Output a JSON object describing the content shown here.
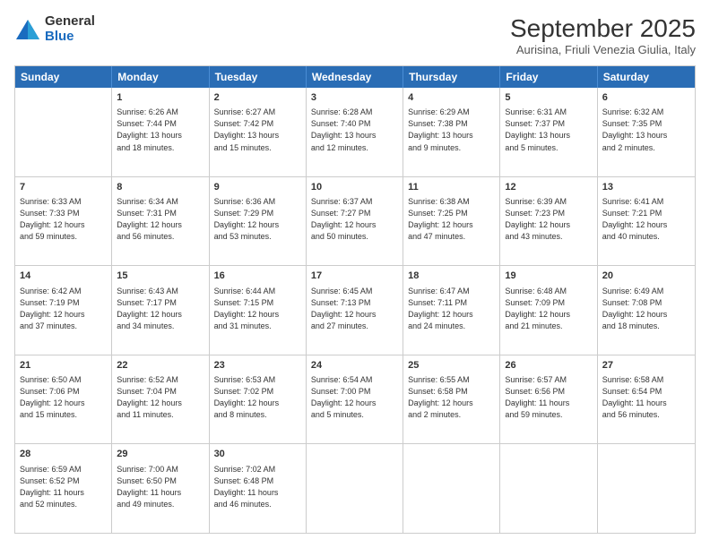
{
  "logo": {
    "general": "General",
    "blue": "Blue"
  },
  "title": "September 2025",
  "subtitle": "Aurisina, Friuli Venezia Giulia, Italy",
  "header_days": [
    "Sunday",
    "Monday",
    "Tuesday",
    "Wednesday",
    "Thursday",
    "Friday",
    "Saturday"
  ],
  "weeks": [
    [
      {
        "day": "",
        "lines": []
      },
      {
        "day": "1",
        "lines": [
          "Sunrise: 6:26 AM",
          "Sunset: 7:44 PM",
          "Daylight: 13 hours",
          "and 18 minutes."
        ]
      },
      {
        "day": "2",
        "lines": [
          "Sunrise: 6:27 AM",
          "Sunset: 7:42 PM",
          "Daylight: 13 hours",
          "and 15 minutes."
        ]
      },
      {
        "day": "3",
        "lines": [
          "Sunrise: 6:28 AM",
          "Sunset: 7:40 PM",
          "Daylight: 13 hours",
          "and 12 minutes."
        ]
      },
      {
        "day": "4",
        "lines": [
          "Sunrise: 6:29 AM",
          "Sunset: 7:38 PM",
          "Daylight: 13 hours",
          "and 9 minutes."
        ]
      },
      {
        "day": "5",
        "lines": [
          "Sunrise: 6:31 AM",
          "Sunset: 7:37 PM",
          "Daylight: 13 hours",
          "and 5 minutes."
        ]
      },
      {
        "day": "6",
        "lines": [
          "Sunrise: 6:32 AM",
          "Sunset: 7:35 PM",
          "Daylight: 13 hours",
          "and 2 minutes."
        ]
      }
    ],
    [
      {
        "day": "7",
        "lines": [
          "Sunrise: 6:33 AM",
          "Sunset: 7:33 PM",
          "Daylight: 12 hours",
          "and 59 minutes."
        ]
      },
      {
        "day": "8",
        "lines": [
          "Sunrise: 6:34 AM",
          "Sunset: 7:31 PM",
          "Daylight: 12 hours",
          "and 56 minutes."
        ]
      },
      {
        "day": "9",
        "lines": [
          "Sunrise: 6:36 AM",
          "Sunset: 7:29 PM",
          "Daylight: 12 hours",
          "and 53 minutes."
        ]
      },
      {
        "day": "10",
        "lines": [
          "Sunrise: 6:37 AM",
          "Sunset: 7:27 PM",
          "Daylight: 12 hours",
          "and 50 minutes."
        ]
      },
      {
        "day": "11",
        "lines": [
          "Sunrise: 6:38 AM",
          "Sunset: 7:25 PM",
          "Daylight: 12 hours",
          "and 47 minutes."
        ]
      },
      {
        "day": "12",
        "lines": [
          "Sunrise: 6:39 AM",
          "Sunset: 7:23 PM",
          "Daylight: 12 hours",
          "and 43 minutes."
        ]
      },
      {
        "day": "13",
        "lines": [
          "Sunrise: 6:41 AM",
          "Sunset: 7:21 PM",
          "Daylight: 12 hours",
          "and 40 minutes."
        ]
      }
    ],
    [
      {
        "day": "14",
        "lines": [
          "Sunrise: 6:42 AM",
          "Sunset: 7:19 PM",
          "Daylight: 12 hours",
          "and 37 minutes."
        ]
      },
      {
        "day": "15",
        "lines": [
          "Sunrise: 6:43 AM",
          "Sunset: 7:17 PM",
          "Daylight: 12 hours",
          "and 34 minutes."
        ]
      },
      {
        "day": "16",
        "lines": [
          "Sunrise: 6:44 AM",
          "Sunset: 7:15 PM",
          "Daylight: 12 hours",
          "and 31 minutes."
        ]
      },
      {
        "day": "17",
        "lines": [
          "Sunrise: 6:45 AM",
          "Sunset: 7:13 PM",
          "Daylight: 12 hours",
          "and 27 minutes."
        ]
      },
      {
        "day": "18",
        "lines": [
          "Sunrise: 6:47 AM",
          "Sunset: 7:11 PM",
          "Daylight: 12 hours",
          "and 24 minutes."
        ]
      },
      {
        "day": "19",
        "lines": [
          "Sunrise: 6:48 AM",
          "Sunset: 7:09 PM",
          "Daylight: 12 hours",
          "and 21 minutes."
        ]
      },
      {
        "day": "20",
        "lines": [
          "Sunrise: 6:49 AM",
          "Sunset: 7:08 PM",
          "Daylight: 12 hours",
          "and 18 minutes."
        ]
      }
    ],
    [
      {
        "day": "21",
        "lines": [
          "Sunrise: 6:50 AM",
          "Sunset: 7:06 PM",
          "Daylight: 12 hours",
          "and 15 minutes."
        ]
      },
      {
        "day": "22",
        "lines": [
          "Sunrise: 6:52 AM",
          "Sunset: 7:04 PM",
          "Daylight: 12 hours",
          "and 11 minutes."
        ]
      },
      {
        "day": "23",
        "lines": [
          "Sunrise: 6:53 AM",
          "Sunset: 7:02 PM",
          "Daylight: 12 hours",
          "and 8 minutes."
        ]
      },
      {
        "day": "24",
        "lines": [
          "Sunrise: 6:54 AM",
          "Sunset: 7:00 PM",
          "Daylight: 12 hours",
          "and 5 minutes."
        ]
      },
      {
        "day": "25",
        "lines": [
          "Sunrise: 6:55 AM",
          "Sunset: 6:58 PM",
          "Daylight: 12 hours",
          "and 2 minutes."
        ]
      },
      {
        "day": "26",
        "lines": [
          "Sunrise: 6:57 AM",
          "Sunset: 6:56 PM",
          "Daylight: 11 hours",
          "and 59 minutes."
        ]
      },
      {
        "day": "27",
        "lines": [
          "Sunrise: 6:58 AM",
          "Sunset: 6:54 PM",
          "Daylight: 11 hours",
          "and 56 minutes."
        ]
      }
    ],
    [
      {
        "day": "28",
        "lines": [
          "Sunrise: 6:59 AM",
          "Sunset: 6:52 PM",
          "Daylight: 11 hours",
          "and 52 minutes."
        ]
      },
      {
        "day": "29",
        "lines": [
          "Sunrise: 7:00 AM",
          "Sunset: 6:50 PM",
          "Daylight: 11 hours",
          "and 49 minutes."
        ]
      },
      {
        "day": "30",
        "lines": [
          "Sunrise: 7:02 AM",
          "Sunset: 6:48 PM",
          "Daylight: 11 hours",
          "and 46 minutes."
        ]
      },
      {
        "day": "",
        "lines": []
      },
      {
        "day": "",
        "lines": []
      },
      {
        "day": "",
        "lines": []
      },
      {
        "day": "",
        "lines": []
      }
    ]
  ]
}
